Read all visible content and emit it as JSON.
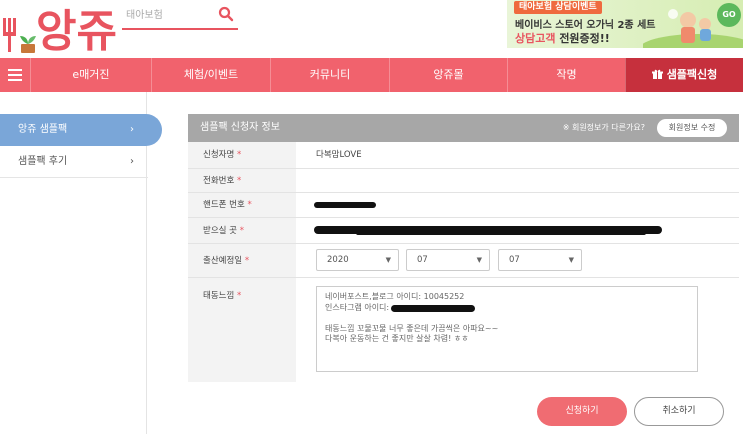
{
  "header": {
    "logo_text": "앙쥬",
    "search_placeholder": "태아보험",
    "banner": {
      "tag": "태아보험 상담이벤트",
      "line1": "베이비스 스토어 오가닉 2종 세트",
      "line2_highlight": "상담고객",
      "line2_rest": " 전원증정!!",
      "badge": "GO"
    }
  },
  "nav": {
    "items": [
      {
        "label": "e매거진"
      },
      {
        "label": "체험/이벤트"
      },
      {
        "label": "커뮤니티"
      },
      {
        "label": "앙쥬몰"
      },
      {
        "label": "작명"
      },
      {
        "label": "샘플팩신청"
      }
    ]
  },
  "sidebar": {
    "items": [
      {
        "label": "앙쥬 샘플팩",
        "chevron": "›"
      },
      {
        "label": "샘플팩 후기",
        "chevron": "›"
      }
    ]
  },
  "form": {
    "title": "샘플팩 신청자 정보",
    "question": "※ 회원정보가 다른가요?",
    "edit_button": "회원정보 수정",
    "required_mark": "*",
    "fields": {
      "name_label": "신청자명",
      "name_value": "다복맘LOVE",
      "phone_label": "전화번호",
      "mobile_label": "핸드폰 번호",
      "address_label": "받으실 곳",
      "due_label": "출산예정일",
      "due_year": "2020",
      "due_month": "07",
      "due_day": "07",
      "note_label": "태동느낌"
    },
    "note_lines": [
      "네이버포스트,블로그 아이디: 10045252",
      "인스타그램 아이디:",
      "",
      "태동느낌 꼬물꼬물 너무 좋은데 가끔씩은 아파요~~",
      "다복아 운동하는 건 좋지만 살살 차렴! ㅎㅎ"
    ],
    "submit_label": "신청하기",
    "cancel_label": "취소하기"
  }
}
